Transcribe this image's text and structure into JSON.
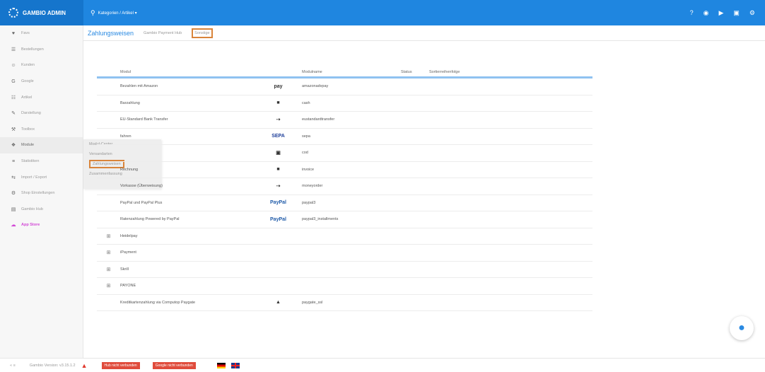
{
  "brand": {
    "title": "GAMBIO ADMIN"
  },
  "search": {
    "label": "Kategorien / Artikel ▾"
  },
  "sidebar": {
    "items": [
      {
        "label": "Favs",
        "icon": "heart-icon",
        "glyph": "♥"
      },
      {
        "label": "Bestellungen",
        "icon": "cart-icon",
        "glyph": "☰"
      },
      {
        "label": "Kunden",
        "icon": "users-icon",
        "glyph": "☺"
      },
      {
        "label": "Google",
        "icon": "google-icon",
        "glyph": "G"
      },
      {
        "label": "Artikel",
        "icon": "sitemap-icon",
        "glyph": "☷"
      },
      {
        "label": "Darstellung",
        "icon": "brush-icon",
        "glyph": "✎"
      },
      {
        "label": "Toolbox",
        "icon": "wrench-icon",
        "glyph": "⚒"
      },
      {
        "label": "Module",
        "icon": "puzzle-icon",
        "glyph": "❖"
      },
      {
        "label": "Statistiken",
        "icon": "chart-icon",
        "glyph": "≡"
      },
      {
        "label": "Import / Export",
        "icon": "exchange-icon",
        "glyph": "⇆"
      },
      {
        "label": "Shop Einstellungen",
        "icon": "gears-icon",
        "glyph": "⚙"
      },
      {
        "label": "Gambio Hub",
        "icon": "hub-icon",
        "glyph": "▤"
      },
      {
        "label": "App Store",
        "icon": "cloud-icon",
        "glyph": "☁"
      }
    ]
  },
  "flyout": {
    "items": [
      "Modul-Center",
      "Versandarten",
      "Zahlungsweisen",
      "Zusammenfassung"
    ]
  },
  "header": {
    "title": "Zahlungsweisen",
    "tabs": [
      "Gambio Payment Hub",
      "Sonstige"
    ]
  },
  "table": {
    "headers": {
      "name": "Modul",
      "code": "Modulname",
      "status": "Status",
      "sort": "Sortierreihenfolge"
    },
    "rows": [
      {
        "expander": "",
        "name": "Bezahlen mit Amazon",
        "logo": "pay",
        "code": "amazonadvpay"
      },
      {
        "expander": "",
        "name": "Barzahlung",
        "logo": "■",
        "code": "cash"
      },
      {
        "expander": "",
        "name": "EU-Standard Bank Transfer",
        "logo": "⇢",
        "code": "eustandardtransfer"
      },
      {
        "expander": "",
        "name": "fahren",
        "logo": "SEPA",
        "code": "sepa"
      },
      {
        "expander": "",
        "name": "",
        "logo": "▣",
        "code": "cod"
      },
      {
        "expander": "",
        "name": "Rechnung",
        "logo": "■",
        "code": "invoice"
      },
      {
        "expander": "",
        "name": "Vorkasse (Überweisung)",
        "logo": "⇢",
        "code": "moneyorder"
      },
      {
        "expander": "",
        "name": "PayPal und PayPal Plus",
        "logo": "PayPal",
        "code": "paypal3"
      },
      {
        "expander": "",
        "name": "Ratenzahlung Powered by PayPal",
        "logo": "PayPal",
        "code": "paypal3_installments"
      },
      {
        "expander": "⊞",
        "name": "Heidelpay",
        "logo": "",
        "code": ""
      },
      {
        "expander": "⊞",
        "name": "iPayment",
        "logo": "",
        "code": ""
      },
      {
        "expander": "⊞",
        "name": "Skrill",
        "logo": "",
        "code": ""
      },
      {
        "expander": "⊞",
        "name": "PAYONE",
        "logo": "",
        "code": ""
      },
      {
        "expander": "",
        "name": "Kreditkartenzahlung via Computop Paygate",
        "logo": "▲",
        "code": "paygate_ssl"
      }
    ]
  },
  "footer": {
    "collapse": "« ≡",
    "version": "Gambio Version: v3.15.1.2",
    "badge1": "Hub nicht verbunden",
    "badge2": "Google nicht verbunden"
  },
  "colors": {
    "primary": "#1f86e0",
    "accent_border": "#d9843a",
    "app_store": "#d24ad6"
  }
}
